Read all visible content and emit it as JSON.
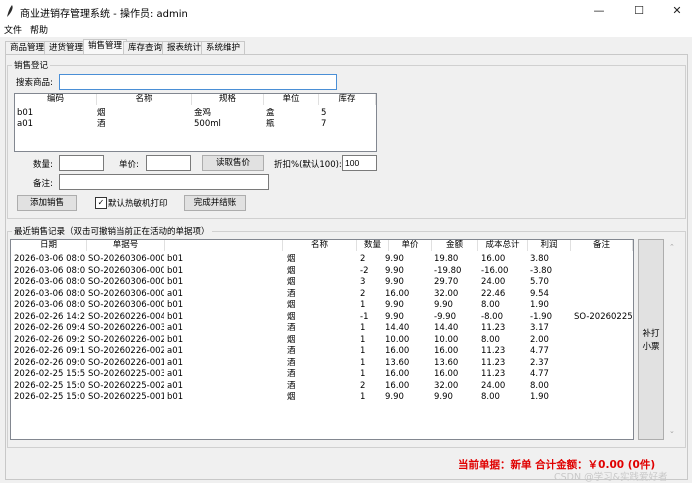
{
  "window": {
    "title": "商业进销存管理系统 - 操作员: admin",
    "minimize": "—",
    "maximize": "☐",
    "close": "✕"
  },
  "menu": [
    "文件",
    "帮助"
  ],
  "tabs": [
    "商品管理",
    "进货管理",
    "销售管理",
    "库存查询",
    "报表统计",
    "系统维护"
  ],
  "active_tab": "销售管理",
  "sales_entry": {
    "group_title": "销售登记",
    "search_label": "搜索商品:",
    "search_value": "",
    "product_columns": [
      "编码",
      "名称",
      "规格",
      "单位",
      "库存"
    ],
    "products": [
      [
        "b01",
        "烟",
        "金鸡",
        "盒",
        "5"
      ],
      [
        "a01",
        "酒",
        "500ml",
        "瓶",
        "7"
      ]
    ],
    "qty_label": "数量:",
    "qty_value": "",
    "price_label": "单价:",
    "price_value": "",
    "read_price_button": "读取售价",
    "discount_label": "折扣%(默认100):",
    "discount_value": "100",
    "note_label": "备注:",
    "note_value": "",
    "add_button": "添加销售",
    "thermal_print_label": "默认热敏机打印",
    "thermal_print_checked": true,
    "finish_button": "完成并结账"
  },
  "recent": {
    "group_title": "最近销售记录（双击可撤销当前正在活动的单据项）",
    "columns": [
      "日期",
      "单据号",
      "",
      "名称",
      "数量",
      "单价",
      "金额",
      "成本总计",
      "利润",
      "备注"
    ],
    "rows": [
      [
        "2026-03-06 08:0",
        "SO-20260306-000",
        "b01",
        "烟",
        "2",
        "9.90",
        "19.80",
        "16.00",
        "3.80",
        ""
      ],
      [
        "2026-03-06 08:0",
        "SO-20260306-000",
        "b01",
        "烟",
        "-2",
        "9.90",
        "-19.80",
        "-16.00",
        "-3.80",
        ""
      ],
      [
        "2026-03-06 08:0",
        "SO-20260306-000",
        "b01",
        "烟",
        "3",
        "9.90",
        "29.70",
        "24.00",
        "5.70",
        ""
      ],
      [
        "2026-03-06 08:0",
        "SO-20260306-000",
        "a01",
        "酒",
        "2",
        "16.00",
        "32.00",
        "22.46",
        "9.54",
        ""
      ],
      [
        "2026-03-06 08:0",
        "SO-20260306-000",
        "b01",
        "烟",
        "1",
        "9.90",
        "9.90",
        "8.00",
        "1.90",
        ""
      ],
      [
        "2026-02-26 14:2",
        "SO-20260226-004",
        "b01",
        "烟",
        "-1",
        "9.90",
        "-9.90",
        "-8.00",
        "-1.90",
        "SO-20260225"
      ],
      [
        "2026-02-26 09:4",
        "SO-20260226-003",
        "a01",
        "酒",
        "1",
        "14.40",
        "14.40",
        "11.23",
        "3.17",
        ""
      ],
      [
        "2026-02-26 09:2",
        "SO-20260226-002",
        "b01",
        "烟",
        "1",
        "10.00",
        "10.00",
        "8.00",
        "2.00",
        ""
      ],
      [
        "2026-02-26 09:1",
        "SO-20260226-002",
        "a01",
        "酒",
        "1",
        "16.00",
        "16.00",
        "11.23",
        "4.77",
        ""
      ],
      [
        "2026-02-26 09:0",
        "SO-20260226-001",
        "a01",
        "酒",
        "1",
        "13.60",
        "13.60",
        "11.23",
        "2.37",
        ""
      ],
      [
        "2026-02-25 15:5",
        "SO-20260225-003",
        "a01",
        "酒",
        "1",
        "16.00",
        "16.00",
        "11.23",
        "4.77",
        ""
      ],
      [
        "2026-02-25 15:0",
        "SO-20260225-002",
        "a01",
        "酒",
        "2",
        "16.00",
        "32.00",
        "24.00",
        "8.00",
        ""
      ],
      [
        "2026-02-25 15:0",
        "SO-20260225-001",
        "b01",
        "烟",
        "1",
        "9.90",
        "9.90",
        "8.00",
        "1.90",
        ""
      ]
    ],
    "reprint_button": "补打\n小票"
  },
  "status_text": "当前单据：新单  合计金额：￥0.00  (0件)",
  "watermark": "CSDN @学习&实践爱好者",
  "icons": {
    "app": "feather-icon",
    "checkbox": "check-icon"
  }
}
